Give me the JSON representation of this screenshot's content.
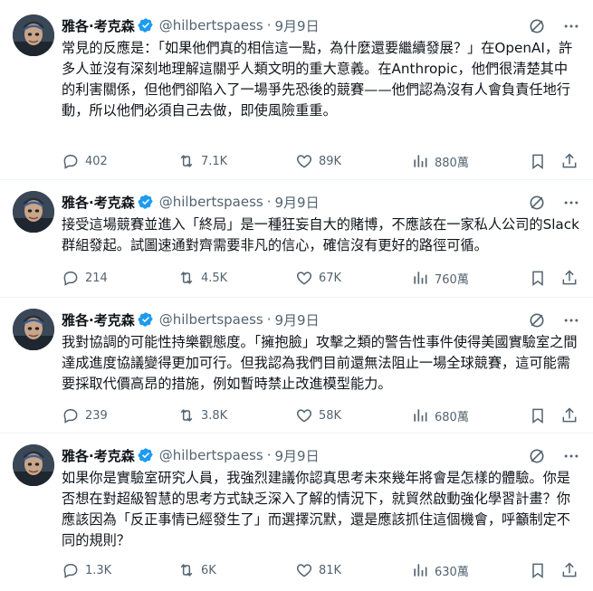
{
  "author": {
    "name": "雅各·考克森",
    "handle": "@hilbertspaess",
    "verified_color": "#1d9bf0"
  },
  "icons": {
    "reply": "reply-bubble-icon",
    "retweet": "retweet-arrows-icon",
    "like": "heart-icon",
    "views": "bar-chart-icon",
    "bookmark": "bookmark-icon",
    "share": "share-upload-icon",
    "grok": "grok-slash-icon",
    "more": "more-dots-icon"
  },
  "tweets": [
    {
      "time": "9月9日",
      "text": "常見的反應是：「如果他們真的相信這一點，為什麼還要繼續發展？」在OpenAI，許多人並沒有深刻地理解這關乎人類文明的重大意義。在Anthropic，他們很清楚其中的利害關係，但他們卻陷入了一場爭先恐後的競賽——他們認為沒有人會負責任地行動，所以他們必須自己去做，即使風險重重。",
      "replies": "402",
      "retweets": "7.1K",
      "likes": "89K",
      "views": "880萬"
    },
    {
      "time": "9月9日",
      "text": "接受這場競賽並進入「終局」是一種狂妄自大的賭博，不應該在一家私人公司的Slack群組發起。試圖速通對齊需要非凡的信心，確信沒有更好的路徑可循。",
      "replies": "214",
      "retweets": "4.5K",
      "likes": "67K",
      "views": "760萬"
    },
    {
      "time": "9月9日",
      "text": "我對協調的可能性持樂觀態度。「擁抱臉」攻擊之類的警告性事件使得美國實驗室之間達成進度協議變得更加可行。但我認為我們目前還無法阻止一場全球競賽，這可能需要採取代價高昂的措施，例如暫時禁止改進模型能力。",
      "replies": "239",
      "retweets": "3.8K",
      "likes": "58K",
      "views": "680萬"
    },
    {
      "time": "9月9日",
      "text": "如果你是實驗室研究人員，我強烈建議你認真思考未來幾年將會是怎樣的體驗。你是否想在對超級智慧的思考方式缺乏深入了解的情況下，就貿然啟動強化學習計畫？你應該因為「反正事情已經發生了」而選擇沉默，還是應該抓住這個機會，呼籲制定不同的規則？",
      "replies": "1.3K",
      "retweets": "6K",
      "likes": "81K",
      "views": "630萬"
    }
  ]
}
